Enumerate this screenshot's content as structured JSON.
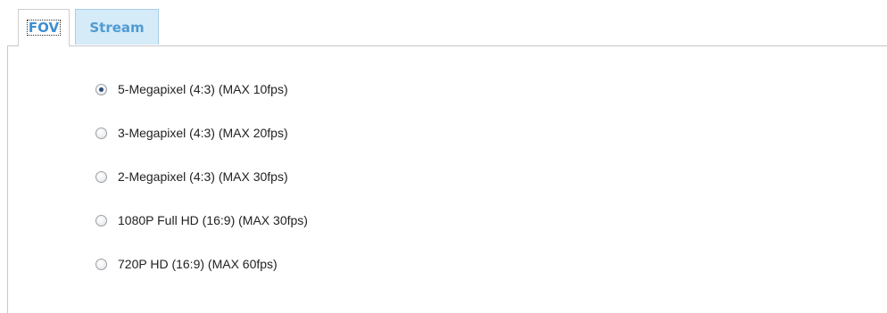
{
  "tabs": [
    {
      "label": "FOV",
      "active": true
    },
    {
      "label": "Stream",
      "active": false
    }
  ],
  "fov_options": [
    {
      "label": "5-Megapixel (4:3) (MAX 10fps)",
      "selected": true
    },
    {
      "label": "3-Megapixel (4:3) (MAX 20fps)",
      "selected": false
    },
    {
      "label": "2-Megapixel (4:3) (MAX 30fps)",
      "selected": false
    },
    {
      "label": "1080P Full HD (16:9) (MAX 30fps)",
      "selected": false
    },
    {
      "label": "720P HD (16:9) (MAX 60fps)",
      "selected": false
    }
  ],
  "colors": {
    "active_tab_text": "#3f8fd0",
    "inactive_tab_bg": "#d6ebf8",
    "inactive_tab_text": "#4f9bd3"
  }
}
